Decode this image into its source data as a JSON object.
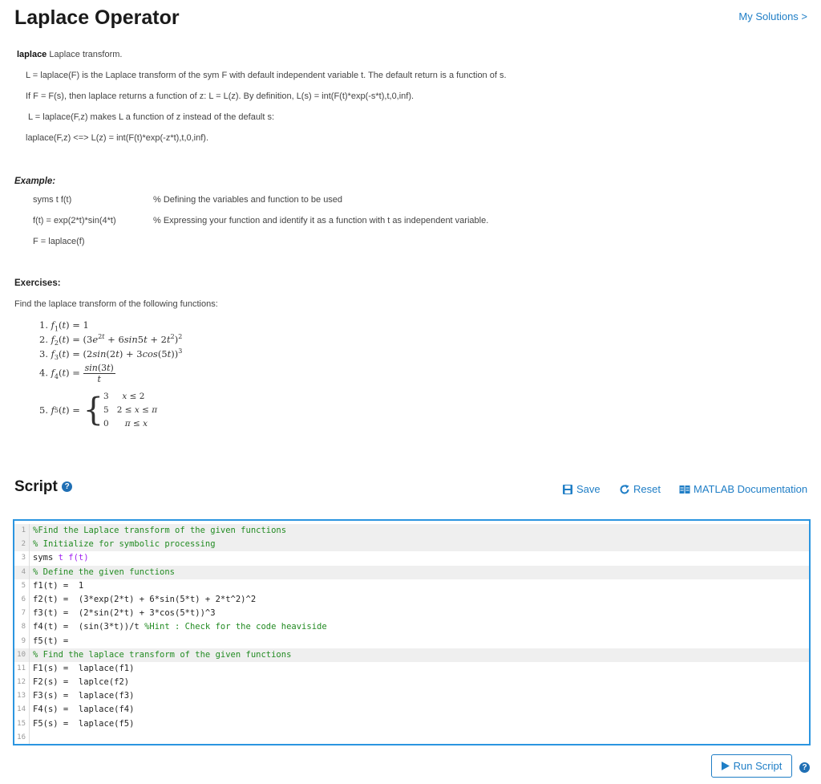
{
  "page": {
    "title": "Laplace Operator",
    "my_solutions": "My Solutions >"
  },
  "description": {
    "keyword": "laplace",
    "keyword_rest": " Laplace transform.",
    "lines": [
      "L = laplace(F) is the Laplace transform of the sym F with default independent variable t.  The default return is a function of s.",
      "If F = F(s), then laplace returns a function of z:  L = L(z).     By definition, L(s) = int(F(t)*exp(-s*t),t,0,inf).",
      "L = laplace(F,z) makes L a function of z instead of the default s:",
      "laplace(F,z) <=> L(z) = int(F(t)*exp(-z*t),t,0,inf)."
    ]
  },
  "example": {
    "heading": "Example:",
    "rows": [
      {
        "code": "syms t f(t)",
        "comment": "% Defining the variables and function to be used"
      },
      {
        "code": "f(t) = exp(2*t)*sin(4*t)",
        "comment": "% Expressing your function and identify it as a function with t as independent variable."
      },
      {
        "code": "F = laplace(f)",
        "comment": ""
      }
    ]
  },
  "exercises": {
    "heading": "Exercises:",
    "intro": "Find the laplace transform of the following functions:",
    "items": [
      {
        "num": "1."
      },
      {
        "num": "2."
      },
      {
        "num": "3."
      },
      {
        "num": "4."
      },
      {
        "num": "5."
      }
    ]
  },
  "script": {
    "heading": "Script",
    "save_label": "Save",
    "reset_label": "Reset",
    "docs_label": "MATLAB Documentation",
    "run_label": "Run Script",
    "lines": [
      "%Find the Laplace transform of the given functions",
      "% Initialize for symbolic processing",
      "syms t f(t)",
      "% Define the given functions",
      "f1(t) =  1",
      "f2(t) =  (3*exp(2*t) + 6*sin(5*t) + 2*t^2)^2",
      "f3(t) =  (2*sin(2*t) + 3*cos(5*t))^3",
      "f4(t) =  (sin(3*t))/t %Hint : Check for the code heaviside",
      "f5(t) =",
      "% Find the laplace transform of the given functions",
      "F1(s) =  laplace(f1)",
      "F2(s) =  laplce(f2)",
      "F3(s) =  laplace(f3)",
      "F4(s) =  laplace(f4)",
      "F5(s) =  laplace(f5)",
      ""
    ]
  },
  "colors": {
    "link": "#1f7ec6",
    "editor_border": "#2b95e0",
    "comment": "#228b22",
    "string_arg": "#a020f0"
  }
}
